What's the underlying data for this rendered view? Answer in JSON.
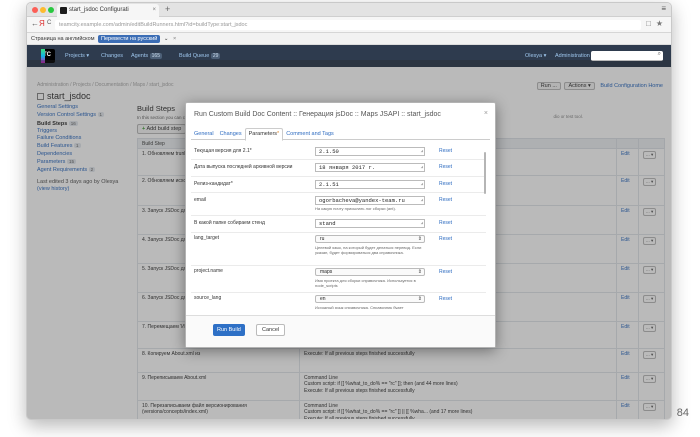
{
  "browser": {
    "tab_title": "start_jsdoc Configurati",
    "tab_close": "×",
    "new_tab": "+",
    "url": "teamcity.example.com/admin/editBuildRunners.html?id=buildType:start_jsdoc",
    "back": "←",
    "yandex": "Я",
    "reload": "C",
    "translate_label": "Страница на английском",
    "translate_button": "Перевести на русский",
    "translate_caret": "⌄",
    "translate_close": "×",
    "menu_icon": "≡",
    "ext_icon": "□",
    "star_icon": "★",
    "download_icon": "⇩"
  },
  "header": {
    "logo": "TC",
    "projects": "Projects",
    "caret": "▾",
    "changes": "Changes",
    "agents": "Agents",
    "agents_count": "165",
    "build_queue": "Build Queue",
    "queue_count": "29",
    "user": "Olesya",
    "administration": "Administration",
    "search_icon": "⌕"
  },
  "page": {
    "breadcrumb": "Administration / Projects / Documentation / Maps / start_jsdoc",
    "title": "start_jsdoc",
    "run_button": "Run",
    "run_dots": "...",
    "actions_button": "Actions",
    "build_config_home": "Build Configuration Home"
  },
  "sidebar": {
    "items": [
      {
        "label": "General Settings",
        "badge": ""
      },
      {
        "label": "Version Control Settings",
        "badge": "1"
      },
      {
        "label": "Build Steps",
        "badge": "16"
      },
      {
        "label": "Triggers",
        "badge": ""
      },
      {
        "label": "Failure Conditions",
        "badge": ""
      },
      {
        "label": "Build Features",
        "badge": "1"
      },
      {
        "label": "Dependencies",
        "badge": ""
      },
      {
        "label": "Parameters",
        "badge": "15"
      },
      {
        "label": "Agent Requirements",
        "badge": "2"
      }
    ],
    "last_edited": "Last edited 3 days ago by Olesya",
    "view_history": "(view history)"
  },
  "main": {
    "heading": "Build Steps",
    "description": "In this section you can configure",
    "desc_right": "dio or test tool.",
    "add_button": "Add build step",
    "add_plus": "+",
    "col_build_step": "Build Step",
    "edit": "Edit",
    "more": "...",
    "steps": [
      {
        "name": "1. Обновляем trunk",
        "details": []
      },
      {
        "name": "2. Обновляем исходники",
        "details": []
      },
      {
        "name": "3. Запуск JSDoc для тест",
        "details": []
      },
      {
        "name": "4. Запуск JSDoc для теку",
        "details": []
      },
      {
        "name": "5. Запуск JSDoc для верс",
        "details": []
      },
      {
        "name": "6. Запуск JSDoc для архи",
        "details": []
      },
      {
        "name": "7. Перемещаем 'Интерфе",
        "details": []
      },
      {
        "name": "8. Копируем About.xml из",
        "details": [
          "Execute: If all previous steps finished successfully"
        ]
      },
      {
        "name": "9. Переписываем About.xml",
        "details": [
          "Command Line",
          "Custom script: if [[ %what_to_do% == \"rc\" ]]; then (and 44 more lines)",
          "Execute: If all previous steps finished successfully"
        ]
      },
      {
        "name": "10. Перезаписываем файл версионирования (versions/concepts/index.xml)",
        "details": [
          "Command Line",
          "Custom script: if [[ %what_to_do% == \"rc\" ]] || [[ %wha... (and 17 more lines)",
          "Execute: If all previous steps finished successfully"
        ]
      }
    ]
  },
  "dialog": {
    "title": "Run Custom Build Doc Content :: Генерация jsDoc :: Maps JSAPI :: start_jsdoc",
    "close": "×",
    "tabs": [
      "General",
      "Changes",
      "Parameters",
      "Comment and Tags"
    ],
    "changed_mark": "*",
    "reset": "Reset",
    "resize": "◢",
    "select_arrow": "⇕",
    "params": [
      {
        "label": "Текущая версия для 2.1*",
        "value": "2.1.50",
        "hint": ""
      },
      {
        "label": "Дата выпуска последней архивной версии",
        "value": "18 января 2017 г.",
        "hint": ""
      },
      {
        "label": "Релиз-кандидат*",
        "value": "2.1.51",
        "hint": ""
      },
      {
        "label": "email",
        "value": "ogorbacheva@yandex-team.ru",
        "hint": "На какую почту присылать лог сборки (ant)."
      },
      {
        "label": "В какой папке собираем стенд",
        "value": "stand",
        "hint": ""
      },
      {
        "label": "lang_target",
        "value": "ru",
        "hint": "Целевой язык, на который будет делаться перевод. Если указан, будет формироваться два справочника."
      },
      {
        "label": "project.name",
        "value": "maps",
        "hint": "Имя проекта для сборки справочника. Используется в node_scripts"
      },
      {
        "label": "source_lang",
        "value": "en",
        "hint": "Исходный язык справочника. Справочник будет собираться в соответствующей папке. Например, если задано значение 'en', то справочник будет собран в папке"
      }
    ],
    "run_build": "Run Build",
    "cancel": "Cancel"
  },
  "page_number": "84"
}
